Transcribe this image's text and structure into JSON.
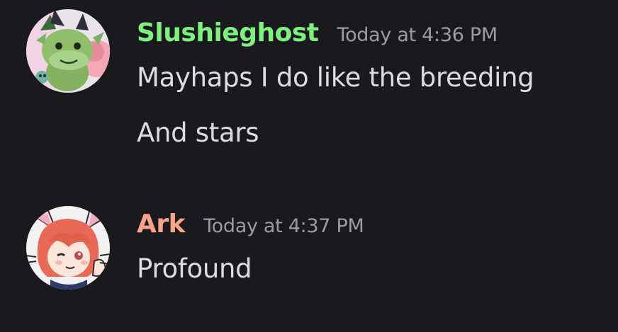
{
  "messages": [
    {
      "username": "Slushieghost",
      "username_color": "#7ef07e",
      "timestamp": "Today at 4:36 PM",
      "avatar_icon": "green-dragon-plush-avatar-icon",
      "lines": [
        "Mayhaps I do like the breeding",
        "And stars"
      ]
    },
    {
      "username": "Ark",
      "username_color": "#f7a489",
      "timestamp": "Today at 4:37 PM",
      "avatar_icon": "red-haired-catgirl-avatar-icon",
      "lines": [
        "Profound"
      ]
    }
  ]
}
